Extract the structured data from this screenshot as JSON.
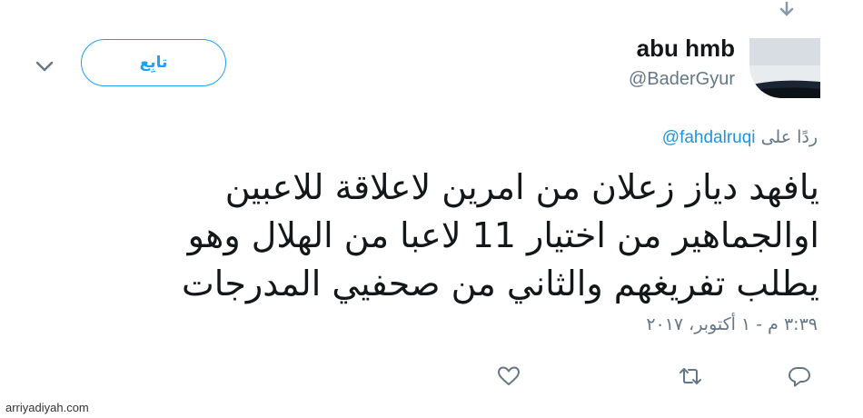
{
  "header": {
    "display_name": "abu hmb",
    "handle": "@BaderGyur",
    "follow_label": "تابِع",
    "icons": {
      "menu": "chevron-down-icon",
      "caret": "caret-down-icon"
    }
  },
  "reply": {
    "prefix": "ردًا على",
    "mention": "@fahdalruqi"
  },
  "tweet": {
    "lines": [
      "يافهد دياز زعلان من امرين لاعلاقة للاعبين",
      "اوالجماهير من اختيار 11 لاعبا من الهلال وهو",
      "يطلب تفريغهم والثاني من صحفيي المدرجات"
    ],
    "timestamp": "٣:٣٩ م - ١ أكتوبر، ٢٠١٧"
  },
  "actions": {
    "icons": [
      "heart-icon",
      "retweet-icon",
      "reply-icon"
    ]
  },
  "watermark": "arriyadiyah.com",
  "colors": {
    "accent": "#1da1f2",
    "text": "#14171a",
    "secondary": "#657786",
    "mention": "#1b95e0"
  }
}
